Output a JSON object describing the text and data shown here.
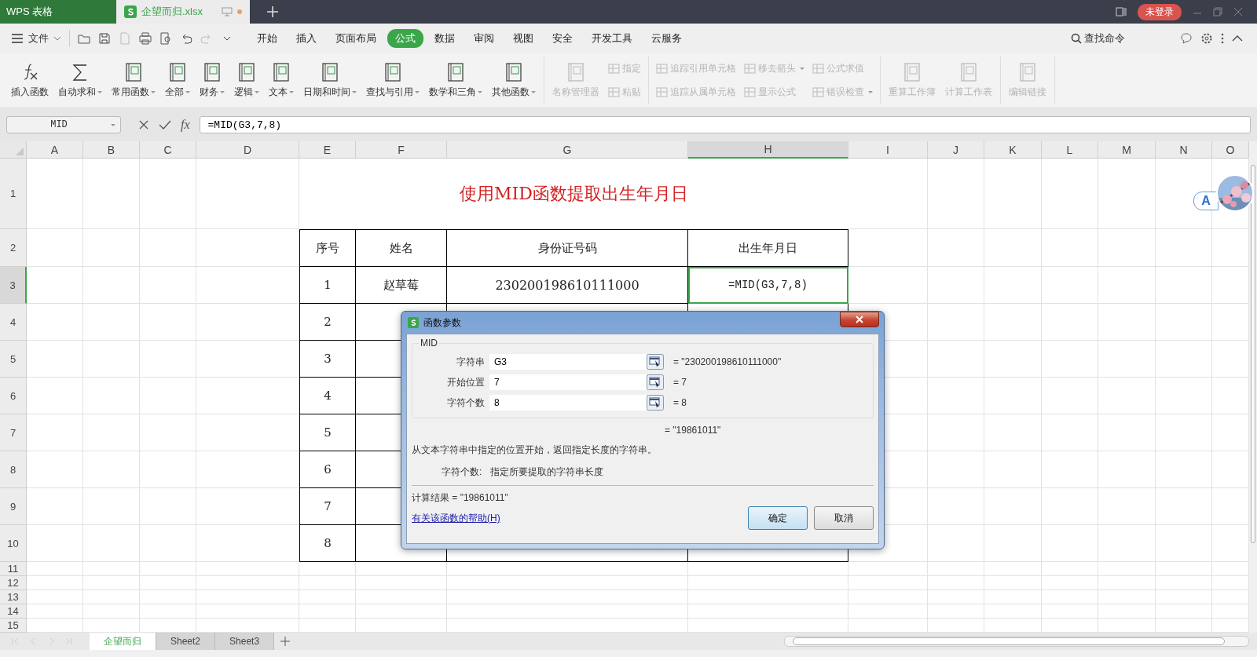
{
  "app_tabs": [
    {
      "label": "WPS 表格",
      "kind": "app",
      "selected": false
    },
    {
      "label": "企望而归.xlsx",
      "kind": "doc",
      "selected": true,
      "unsaved": true
    }
  ],
  "account_button": "未登录",
  "menu": {
    "file": "文件",
    "tabs": [
      {
        "label": "开始",
        "selected": false
      },
      {
        "label": "插入",
        "selected": false
      },
      {
        "label": "页面布局",
        "selected": false
      },
      {
        "label": "公式",
        "selected": true
      },
      {
        "label": "数据",
        "selected": false
      },
      {
        "label": "审阅",
        "selected": false
      },
      {
        "label": "视图",
        "selected": false
      },
      {
        "label": "安全",
        "selected": false
      },
      {
        "label": "开发工具",
        "selected": false
      },
      {
        "label": "云服务",
        "selected": false
      }
    ],
    "search": "查找命令"
  },
  "ribbon": [
    {
      "items": [
        {
          "kind": "big",
          "label": "插入函数",
          "dropdown": false,
          "disabled": false
        },
        {
          "kind": "big",
          "label": "自动求和",
          "dropdown": true,
          "disabled": false
        },
        {
          "kind": "big",
          "label": "常用函数",
          "dropdown": true,
          "disabled": false
        },
        {
          "kind": "big",
          "label": "全部",
          "dropdown": true,
          "disabled": false
        },
        {
          "kind": "big",
          "label": "财务",
          "dropdown": true,
          "disabled": false
        },
        {
          "kind": "big",
          "label": "逻辑",
          "dropdown": true,
          "disabled": false
        },
        {
          "kind": "big",
          "label": "文本",
          "dropdown": true,
          "disabled": false
        },
        {
          "kind": "big",
          "label": "日期和时间",
          "dropdown": true,
          "disabled": false
        },
        {
          "kind": "big",
          "label": "查找与引用",
          "dropdown": true,
          "disabled": false
        },
        {
          "kind": "big",
          "label": "数学和三角",
          "dropdown": true,
          "disabled": false
        },
        {
          "kind": "big",
          "label": "其他函数",
          "dropdown": true,
          "disabled": false
        }
      ]
    },
    {
      "items": [
        {
          "kind": "big",
          "label": "名称管理器",
          "dropdown": false,
          "disabled": true
        },
        {
          "kind": "small",
          "label": "指定",
          "dropdown": false,
          "disabled": true
        },
        {
          "kind": "small",
          "label": "粘贴",
          "dropdown": false,
          "disabled": true
        }
      ]
    },
    {
      "items": [
        {
          "kind": "small",
          "label": "追踪引用单元格",
          "dropdown": false,
          "disabled": true
        },
        {
          "kind": "small",
          "label": "追踪从属单元格",
          "dropdown": false,
          "disabled": true
        },
        {
          "kind": "small",
          "label": "移去箭头",
          "dropdown": true,
          "disabled": true
        },
        {
          "kind": "small",
          "label": "显示公式",
          "dropdown": false,
          "disabled": true
        },
        {
          "kind": "small",
          "label": "公式求值",
          "dropdown": false,
          "disabled": true
        },
        {
          "kind": "small",
          "label": "错误检查",
          "dropdown": true,
          "disabled": true
        }
      ]
    },
    {
      "items": [
        {
          "kind": "big",
          "label": "重算工作簿",
          "dropdown": false,
          "disabled": true
        },
        {
          "kind": "big",
          "label": "计算工作表",
          "dropdown": false,
          "disabled": true
        }
      ]
    },
    {
      "items": [
        {
          "kind": "big",
          "label": "编辑链接",
          "dropdown": false,
          "disabled": true
        }
      ]
    }
  ],
  "formula_bar": {
    "name_box": "MID",
    "fx": "fx",
    "formula": "=MID(G3,7,8)"
  },
  "columns": [
    {
      "label": "A",
      "selected": false
    },
    {
      "label": "B",
      "selected": false
    },
    {
      "label": "C",
      "selected": false
    },
    {
      "label": "D",
      "selected": false
    },
    {
      "label": "E",
      "selected": false
    },
    {
      "label": "F",
      "selected": false
    },
    {
      "label": "G",
      "selected": false
    },
    {
      "label": "H",
      "selected": true
    },
    {
      "label": "I",
      "selected": false
    },
    {
      "label": "J",
      "selected": false
    },
    {
      "label": "K",
      "selected": false
    },
    {
      "label": "L",
      "selected": false
    },
    {
      "label": "M",
      "selected": false
    },
    {
      "label": "N",
      "selected": false
    },
    {
      "label": "O",
      "selected": false
    }
  ],
  "rows": [
    {
      "label": "1",
      "selected": false
    },
    {
      "label": "2",
      "selected": false
    },
    {
      "label": "3",
      "selected": true
    },
    {
      "label": "4",
      "selected": false
    },
    {
      "label": "5",
      "selected": false
    },
    {
      "label": "6",
      "selected": false
    },
    {
      "label": "7",
      "selected": false
    },
    {
      "label": "8",
      "selected": false
    },
    {
      "label": "9",
      "selected": false
    },
    {
      "label": "10",
      "selected": false
    },
    {
      "label": "11",
      "selected": false
    },
    {
      "label": "12",
      "selected": false
    },
    {
      "label": "13",
      "selected": false
    },
    {
      "label": "14",
      "selected": false
    },
    {
      "label": "15",
      "selected": false
    }
  ],
  "sheet_title": "使用MID函数提取出生年月日",
  "table": {
    "header": [
      "序号",
      "姓名",
      "身份证号码",
      "出生年月日"
    ],
    "rows": [
      [
        {
          "text": "1",
          "selected": false
        },
        {
          "text": "赵草莓",
          "selected": false
        },
        {
          "text": "230200198610111000",
          "selected": false
        },
        {
          "text": "=MID(G3,7,8)",
          "selected": true
        }
      ],
      [
        {
          "text": "2",
          "selected": false
        }
      ],
      [
        {
          "text": "3",
          "selected": false
        }
      ],
      [
        {
          "text": "4",
          "selected": false
        }
      ],
      [
        {
          "text": "5",
          "selected": false
        }
      ],
      [
        {
          "text": "6",
          "selected": false
        }
      ],
      [
        {
          "text": "7",
          "selected": false
        }
      ],
      [
        {
          "text": "8",
          "selected": false
        }
      ]
    ]
  },
  "float_button": "A",
  "dialog": {
    "title": "函数参数",
    "function": "MID",
    "args": [
      {
        "label": "字符串",
        "value": "G3",
        "result": "= \"230200198610111000\""
      },
      {
        "label": "开始位置",
        "value": "7",
        "result": "= 7"
      },
      {
        "label": "字符个数",
        "value": "8",
        "result": "= 8"
      }
    ],
    "result": "= \"19861011\"",
    "description": "从文本字符串中指定的位置开始，返回指定长度的字符串。",
    "arg_name": "字符个数:",
    "arg_help": "指定所要提取的字符串长度",
    "calc_result": "计算结果 = \"19861011\"",
    "help_link": "有关该函数的帮助(H)",
    "buttons": [
      {
        "label": "确定",
        "default": true
      },
      {
        "label": "取消",
        "default": false
      }
    ]
  },
  "sheet_tabs": [
    {
      "label": "企望而归",
      "selected": true
    },
    {
      "label": "Sheet2",
      "selected": false
    },
    {
      "label": "Sheet3",
      "selected": false
    }
  ]
}
